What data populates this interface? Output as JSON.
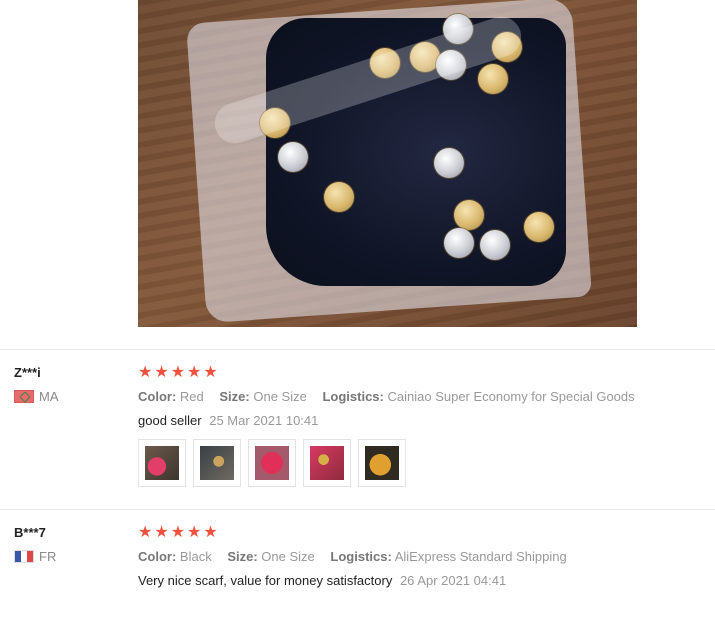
{
  "hero_photo": {
    "description_icon": "product-photo"
  },
  "reviews": [
    {
      "user": "Z***i",
      "country": "MA",
      "rating": 5,
      "stars": [
        "★",
        "★",
        "★",
        "★",
        "★"
      ],
      "color_label": "Color:",
      "color": "Red",
      "size_label": "Size:",
      "size": "One Size",
      "logistics_label": "Logistics:",
      "logistics": "Cainiao Super Economy for Special Goods",
      "text": "good seller",
      "date": "25 Mar 2021 10:41",
      "photo_count": 5
    },
    {
      "user": "B***7",
      "country": "FR",
      "rating": 5,
      "stars": [
        "★",
        "★",
        "★",
        "★",
        "★"
      ],
      "color_label": "Color:",
      "color": "Black",
      "size_label": "Size:",
      "size": "One Size",
      "logistics_label": "Logistics:",
      "logistics": "AliExpress Standard Shipping",
      "text": "Very nice scarf, value for money satisfactory",
      "date": "26 Apr 2021 04:41",
      "photo_count": 0
    }
  ],
  "colors": {
    "star": "#f0523f",
    "divider": "#e8e8e8",
    "muted": "#999999"
  }
}
